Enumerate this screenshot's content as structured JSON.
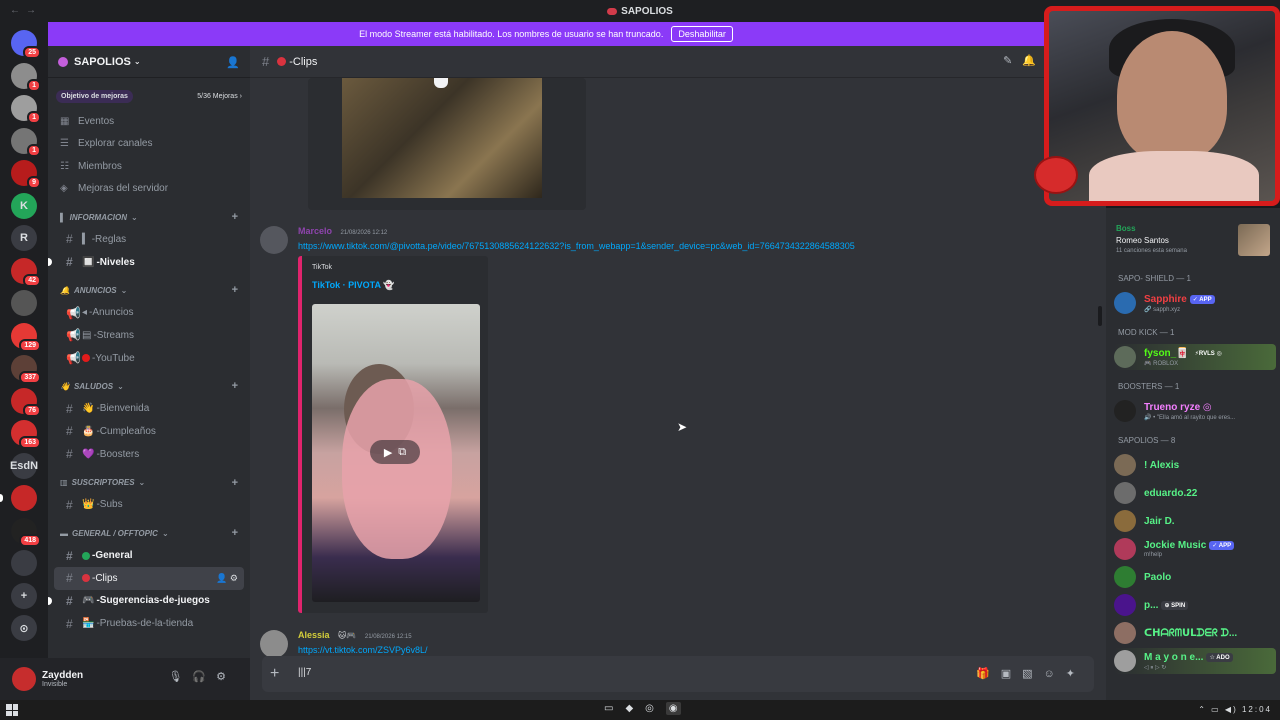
{
  "window": {
    "title": "SAPOLIOS",
    "back": "←",
    "forward": "→"
  },
  "streamer_banner": {
    "text": "El modo Streamer está habilitado. Los nombres de usuario se han truncado.",
    "button": "Deshabilitar"
  },
  "guilds": [
    {
      "badge": "25"
    },
    {
      "badge": "1"
    },
    {
      "badge": "1"
    },
    {
      "badge": "1"
    },
    {
      "badge": "9"
    },
    {
      "label": "K"
    },
    {
      "label": "R"
    },
    {
      "badge": "42"
    },
    {
      "badge": ""
    },
    {
      "badge": "129"
    },
    {
      "badge": "337"
    },
    {
      "badge": "76"
    },
    {
      "badge": "163"
    },
    {
      "label": "EsdN"
    },
    {
      "badge": ""
    },
    {
      "badge": "418"
    },
    {
      "badge": ""
    },
    {
      "label": "+"
    },
    {
      "label": "⊙"
    }
  ],
  "server": {
    "name": "SAPOLIOS",
    "boost_goal_label": "Objetivo de mejoras",
    "boost_goal_count": "5/36 Mejoras",
    "nav": [
      {
        "icon": "calendar-icon",
        "glyph": "▦",
        "label": "Eventos"
      },
      {
        "icon": "browse-channels-icon",
        "glyph": "☰",
        "label": "Explorar canales"
      },
      {
        "icon": "members-icon",
        "glyph": "☷",
        "label": "Miembros"
      },
      {
        "icon": "boost-icon",
        "glyph": "◈",
        "label": "Mejoras del servidor"
      }
    ],
    "categories": [
      {
        "name": "INFORMACION",
        "prefix": "▌",
        "channels": [
          {
            "label": "-Reglas",
            "prefix": "▍",
            "bold": false
          },
          {
            "label": "-Niveles",
            "prefix": "🔲",
            "bold": true,
            "unread": true
          }
        ]
      },
      {
        "name": "ANUNCIOS",
        "prefix": "🔔",
        "channels": [
          {
            "label": "-Anuncios",
            "prefix": "◂",
            "bold": false,
            "announce": true
          },
          {
            "label": "-Streams",
            "prefix": "▤",
            "bold": false,
            "announce": true
          },
          {
            "label": "-YouTube",
            "prefix": "●",
            "bold": false,
            "announce": true,
            "dot": "#e21b1b"
          }
        ]
      },
      {
        "name": "SALUDOS",
        "prefix": "👋",
        "channels": [
          {
            "label": "-Bienvenida",
            "prefix": "👋",
            "bold": false
          },
          {
            "label": "-Cumpleaños",
            "prefix": "🎂",
            "bold": false
          },
          {
            "label": "-Boosters",
            "prefix": "💜",
            "bold": false
          }
        ]
      },
      {
        "name": "SUSCRIPTORES",
        "prefix": "▥",
        "channels": [
          {
            "label": "-Subs",
            "prefix": "👑",
            "bold": false
          }
        ]
      },
      {
        "name": "GENERAL / OFFTOPIC",
        "prefix": "▬",
        "channels": [
          {
            "label": "-General",
            "prefix": "●",
            "bold": true,
            "dot": "#23a559"
          },
          {
            "label": "-Clips",
            "prefix": "●",
            "bold": false,
            "active": true,
            "dot": "#d9333f"
          },
          {
            "label": "-Sugerencias-de-juegos",
            "prefix": "🎮",
            "bold": true,
            "unread": true
          },
          {
            "label": "-Pruebas-de-la-tienda",
            "prefix": "🏪",
            "bold": false
          }
        ]
      }
    ]
  },
  "user_panel": {
    "name": "Zaydden",
    "status": "Invisible"
  },
  "channel": {
    "name": "-Clips"
  },
  "messages": [
    {
      "author": "Marcelo",
      "author_color": "#8e44ad",
      "time": "21/08/2026 12:12",
      "link": "https://www.tiktok.com/@pivotta.pe/video/7675130885624122632?is_from_webapp=1&sender_device=pc&web_id=7664734322864588305",
      "embed": {
        "provider": "TikTok",
        "title": "TikTok · PIVOTA 👻"
      }
    },
    {
      "author": "Alessia",
      "author_color": "#d4ce3a",
      "author_suffix": "🐱🎮",
      "time": "21/08/2026 12:15",
      "link": "https://vt.tiktok.com/ZSVPy6v8L/"
    }
  ],
  "composer": {
    "gif": "|||7"
  },
  "now_playing": {
    "label": "Boss",
    "title": "Romeo Santos",
    "sub": "11 canciones esta semana"
  },
  "member_groups": [
    {
      "label": "SAPO- SHIELD — 1",
      "members": [
        {
          "name": "Sapphire",
          "color": "#f23f43",
          "tag": "✓ APP",
          "tag_color": "#5865f2",
          "sub": "🔗 sapph.xyz",
          "av": "#2a6bb0"
        }
      ]
    },
    {
      "label": "MOD KICK — 1",
      "members": [
        {
          "name": "fyson_🀄",
          "color": "#53fc18",
          "tag": "⚡RVLS ◎",
          "tag_color": "transparent",
          "sub": "🎮 ROBLOX",
          "av": "#5d6b5a",
          "highlight": true
        }
      ]
    },
    {
      "label": "BOOSTERS — 1",
      "members": [
        {
          "name": "Trueno ryze ◎",
          "color": "#f47fff",
          "tag": "",
          "tag_color": "transparent",
          "sub": "🔊 • \"Ella amó al rayito que eres...",
          "av": "#222"
        }
      ]
    },
    {
      "label": "SAPOLIOS — 8",
      "members": [
        {
          "name": "! Alexis",
          "color": "#57f287",
          "av": "#7b6a55"
        },
        {
          "name": "eduardo.22",
          "color": "#57f287",
          "av": "#6c6c6c"
        },
        {
          "name": "Jair D.",
          "color": "#57f287",
          "av": "#8a6b3c"
        },
        {
          "name": "Jockie Music",
          "color": "#57f287",
          "tag": "✓ APP",
          "tag_color": "#5865f2",
          "sub": "m!help",
          "av": "#b03a5a"
        },
        {
          "name": "Paolo",
          "color": "#57f287",
          "av": "#2e7d32"
        },
        {
          "name": "p...",
          "color": "#57f287",
          "tag": "⊕ SPIN",
          "tag_color": "#3a3c43",
          "av": "#4a148c"
        },
        {
          "name": "ᑕᕼᗩᖇᗰᑌᒪᗪᗴᖇ ᗪ...",
          "color": "#57f287",
          "av": "#8d6e63"
        },
        {
          "name": "M a y o n e...",
          "color": "#57f287",
          "tag": "☆ ADO",
          "tag_color": "#3a3c43",
          "sub": "◁ ⏸ ▷ ↻",
          "av": "#9e9e9e",
          "highlight": true
        }
      ]
    }
  ],
  "taskbar": {
    "clock": "12:04"
  }
}
